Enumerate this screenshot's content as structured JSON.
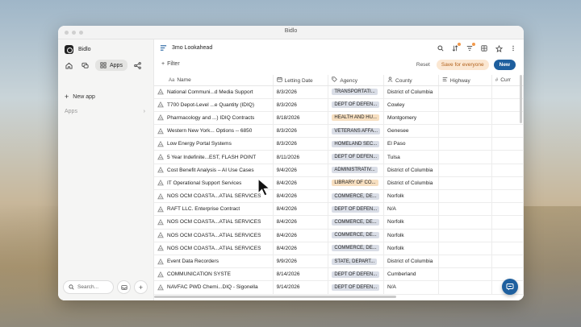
{
  "window": {
    "title": "Bidlo"
  },
  "brand": {
    "name": "Bidlo"
  },
  "sidebar": {
    "apps_label": "Apps",
    "new_app_label": "New app",
    "apps_section_label": "Apps",
    "search_placeholder": "Search..."
  },
  "view": {
    "title": "3mo Lookahead"
  },
  "toolbar": {
    "filter_label": "Filter",
    "reset_label": "Reset",
    "save_label": "Save for everyone",
    "new_label": "New"
  },
  "columns": [
    {
      "icon": "Aa",
      "label": "Name"
    },
    {
      "icon": "calendar-icon",
      "label": "Letting Date"
    },
    {
      "icon": "tag-icon",
      "label": "Agency"
    },
    {
      "icon": "person-icon",
      "label": "County"
    },
    {
      "icon": "lines-icon",
      "label": "Highway"
    },
    {
      "icon": "#",
      "label": "Curr"
    }
  ],
  "rows": [
    {
      "name": "National Communi...d Media Support",
      "date": "8/3/2026",
      "agency": "TRANSPORTATI...",
      "agency_color": "#d9dde6",
      "county": "District of Columbia"
    },
    {
      "name": "T700 Depot-Level ...e Quantity (IDIQ)",
      "date": "8/3/2026",
      "agency": "DEPT OF DEFEN...",
      "agency_color": "#d9dde6",
      "county": "Cowley"
    },
    {
      "name": "Pharmacology and ...) IDIQ Contracts",
      "date": "8/18/2026",
      "agency": "HEALTH AND HU...",
      "agency_color": "#f7dfc0",
      "county": "Montgomery"
    },
    {
      "name": "Western New York... Options -- 6850",
      "date": "8/3/2026",
      "agency": "VETERANS AFFA...",
      "agency_color": "#d9dde6",
      "county": "Genesee"
    },
    {
      "name": "Low Energy Portal Systems",
      "date": "8/3/2026",
      "agency": "HOMELAND SEC...",
      "agency_color": "#d9dde6",
      "county": "El Paso"
    },
    {
      "name": "5 Year Indefinite...EST, FLASH POINT",
      "date": "8/11/2026",
      "agency": "DEPT OF DEFEN...",
      "agency_color": "#d9dde6",
      "county": "Tulsa"
    },
    {
      "name": "Cost Benefit Analysis – AI Use Cases",
      "date": "9/4/2026",
      "agency": "ADMINISTRATIV...",
      "agency_color": "#d9dde6",
      "county": "District of Columbia"
    },
    {
      "name": "IT Operational Support Services",
      "date": "8/4/2026",
      "agency": "LIBRARY OF CO...",
      "agency_color": "#f7dfc0",
      "county": "District of Columbia"
    },
    {
      "name": "NOS OCM COASTA...ATIAL SERVICES",
      "date": "8/4/2026",
      "agency": "COMMERCE, DE...",
      "agency_color": "#d9dde6",
      "county": "Norfolk"
    },
    {
      "name": "RAFT LLC. Enterprise Contract",
      "date": "8/4/2026",
      "agency": "DEPT OF DEFEN...",
      "agency_color": "#d9dde6",
      "county": "N/A"
    },
    {
      "name": "NOS OCM COASTA...ATIAL SERVICES",
      "date": "8/4/2026",
      "agency": "COMMERCE, DE...",
      "agency_color": "#d9dde6",
      "county": "Norfolk"
    },
    {
      "name": "NOS OCM COASTA...ATIAL SERVICES",
      "date": "8/4/2026",
      "agency": "COMMERCE, DE...",
      "agency_color": "#d9dde6",
      "county": "Norfolk"
    },
    {
      "name": "NOS OCM COASTA...ATIAL SERVICES",
      "date": "8/4/2026",
      "agency": "COMMERCE, DE...",
      "agency_color": "#d9dde6",
      "county": "Norfolk"
    },
    {
      "name": "Event Data Recorders",
      "date": "9/9/2026",
      "agency": "STATE, DEPART...",
      "agency_color": "#d9dde6",
      "county": "District of Columbia"
    },
    {
      "name": "COMMUNICATION SYSTE",
      "date": "8/14/2026",
      "agency": "DEPT OF DEFEN...",
      "agency_color": "#d9dde6",
      "county": "Cumberland"
    },
    {
      "name": "NAVFAC PWD Chemi...DIQ - Sigonella",
      "date": "9/14/2026",
      "agency": "DEPT OF DEFEN...",
      "agency_color": "#d9dde6",
      "county": "N/A"
    }
  ],
  "colors": {
    "accent": "#1e5f9e",
    "save_bg": "#fbe7d2",
    "save_text": "#b2621c"
  }
}
